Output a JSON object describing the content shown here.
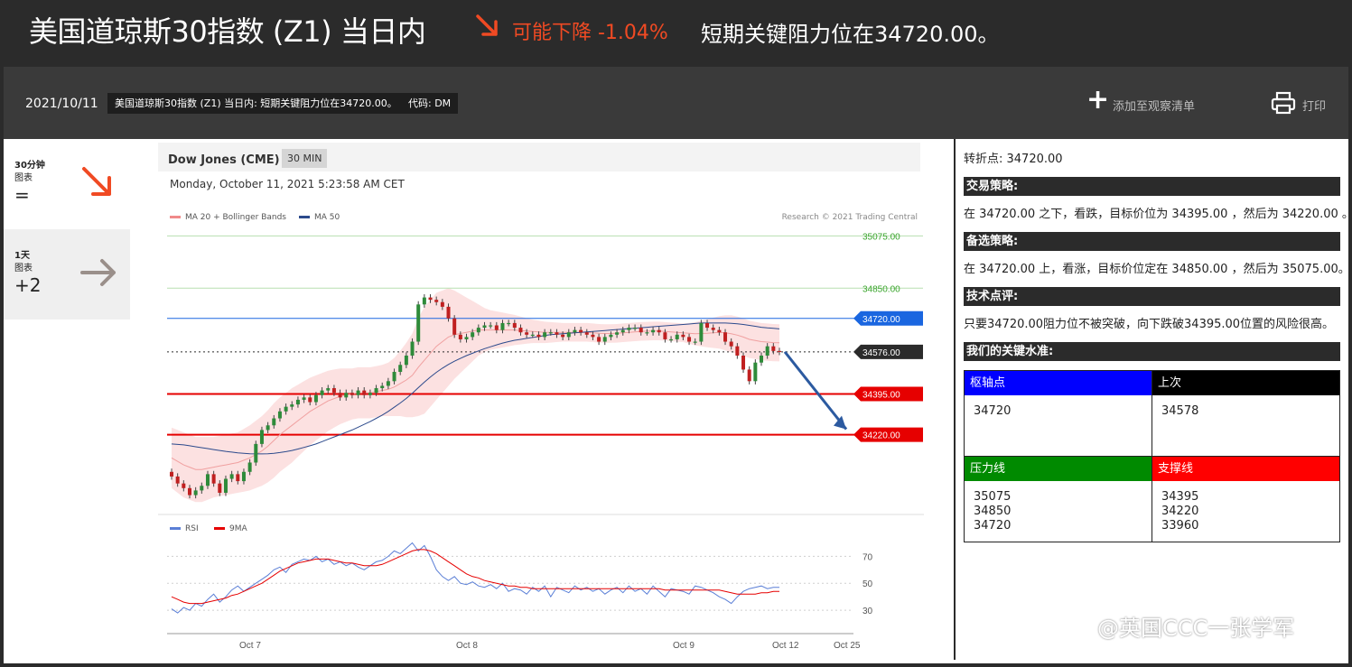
{
  "header": {
    "title": "美国道琼斯30指数 (Z1) 当日内",
    "trend_text": "可能下降 -1.04%",
    "headline": "短期关键阻力位在34720.00。",
    "colors": {
      "accent": "#f04a23"
    }
  },
  "subbar": {
    "date": "2021/10/11",
    "tag_title": "美国道琼斯30指数 (Z1) 当日内: 短期关键阻力位在34720.00。",
    "tag_code": "代码: DM",
    "watchlist_label": "添加至观察清单",
    "print_label": "打印"
  },
  "tabs": [
    {
      "title": "30分钟",
      "subtitle": "图表",
      "value": "="
    },
    {
      "title": "1天",
      "subtitle": "图表",
      "value": "+2"
    }
  ],
  "chart": {
    "name": "Dow Jones (CME)",
    "timeframe": "30 MIN",
    "datetime": "Monday, October 11, 2021 5:23:58 AM CET",
    "legend_ma20": "MA 20 + Bollinger Bands",
    "legend_ma50": "MA 50",
    "credit": "Research © 2021 Trading Central",
    "legend_rsi": "RSI",
    "legend_9ma": "9MA"
  },
  "chart_data": [
    {
      "type": "candlestick",
      "levels": [
        {
          "label": "35075.00",
          "value": 35075,
          "color": "#3aa52d"
        },
        {
          "label": "34850.00",
          "value": 34850,
          "color": "#3aa52d"
        },
        {
          "label": "34720.00",
          "value": 34720,
          "color": "#1a66e0"
        },
        {
          "label": "34576.00",
          "value": 34576,
          "color": "#2b2b2b"
        },
        {
          "label": "34395.00",
          "value": 34395,
          "color": "#e60000"
        },
        {
          "label": "34220.00",
          "value": 34220,
          "color": "#e60000"
        }
      ],
      "ylim": [
        33900,
        35150
      ],
      "closes": [
        34040,
        34010,
        33990,
        33960,
        33980,
        34000,
        34050,
        34010,
        33970,
        34030,
        34050,
        34020,
        34060,
        34100,
        34180,
        34240,
        34260,
        34290,
        34320,
        34340,
        34350,
        34370,
        34380,
        34360,
        34390,
        34410,
        34420,
        34400,
        34380,
        34400,
        34390,
        34410,
        34390,
        34400,
        34420,
        34430,
        34450,
        34490,
        34520,
        34560,
        34620,
        34780,
        34810,
        34800,
        34790,
        34770,
        34720,
        34650,
        34630,
        34640,
        34660,
        34680,
        34690,
        34690,
        34670,
        34700,
        34700,
        34680,
        34660,
        34650,
        34650,
        34640,
        34660,
        34660,
        34650,
        34640,
        34660,
        34670,
        34660,
        34650,
        34640,
        34620,
        34640,
        34650,
        34660,
        34670,
        34680,
        34680,
        34660,
        34660,
        34670,
        34660,
        34630,
        34630,
        34650,
        34640,
        34620,
        34620,
        34700,
        34680,
        34670,
        34660,
        34620,
        34600,
        34560,
        34500,
        34450,
        34530,
        34560,
        34600,
        34580,
        34576
      ],
      "ma20": [
        34120,
        34105,
        34090,
        34080,
        34070,
        34070,
        34075,
        34080,
        34085,
        34090,
        34095,
        34100,
        34110,
        34120,
        34135,
        34150,
        34170,
        34195,
        34220,
        34240,
        34260,
        34280,
        34300,
        34320,
        34335,
        34350,
        34365,
        34375,
        34385,
        34390,
        34395,
        34400,
        34400,
        34400,
        34405,
        34410,
        34415,
        34425,
        34440,
        34455,
        34475,
        34510,
        34540,
        34570,
        34600,
        34620,
        34640,
        34650,
        34655,
        34660,
        34665,
        34670,
        34670,
        34670,
        34670,
        34670,
        34670,
        34670,
        34668,
        34666,
        34664,
        34662,
        34660,
        34660,
        34660,
        34660,
        34660,
        34660,
        34660,
        34660,
        34658,
        34656,
        34655,
        34655,
        34656,
        34658,
        34660,
        34662,
        34664,
        34665,
        34666,
        34666,
        34664,
        34662,
        34660,
        34658,
        34656,
        34654,
        34655,
        34656,
        34658,
        34660,
        34658,
        34654,
        34648,
        34640,
        34630,
        34625,
        34620,
        34618,
        34616,
        34615
      ],
      "ma50": [
        34180,
        34178,
        34176,
        34172,
        34168,
        34164,
        34160,
        34156,
        34152,
        34148,
        34145,
        34142,
        34140,
        34138,
        34137,
        34137,
        34138,
        34140,
        34143,
        34147,
        34152,
        34158,
        34165,
        34172,
        34180,
        34190,
        34200,
        34210,
        34220,
        34230,
        34240,
        34252,
        34264,
        34276,
        34290,
        34304,
        34320,
        34338,
        34356,
        34376,
        34398,
        34422,
        34446,
        34468,
        34488,
        34506,
        34522,
        34536,
        34548,
        34560,
        34570,
        34580,
        34590,
        34598,
        34606,
        34614,
        34620,
        34626,
        34630,
        34634,
        34638,
        34642,
        34646,
        34650,
        34652,
        34654,
        34656,
        34658,
        34660,
        34662,
        34664,
        34666,
        34668,
        34670,
        34672,
        34674,
        34676,
        34678,
        34680,
        34682,
        34684,
        34686,
        34688,
        34690,
        34692,
        34694,
        34696,
        34698,
        34700,
        34700,
        34700,
        34700,
        34700,
        34699,
        34697,
        34694,
        34690,
        34686,
        34682,
        34679,
        34677,
        34675
      ],
      "band_width": [
        130,
        135,
        140,
        140,
        140,
        140,
        135,
        130,
        130,
        130,
        130,
        130,
        135,
        140,
        145,
        150,
        155,
        160,
        160,
        160,
        160,
        155,
        150,
        145,
        140,
        135,
        130,
        125,
        120,
        115,
        110,
        110,
        110,
        110,
        110,
        110,
        115,
        125,
        140,
        160,
        180,
        210,
        230,
        230,
        230,
        220,
        210,
        190,
        170,
        150,
        130,
        110,
        95,
        85,
        80,
        75,
        70,
        65,
        60,
        55,
        50,
        48,
        46,
        44,
        42,
        40,
        40,
        40,
        40,
        40,
        40,
        40,
        40,
        40,
        40,
        40,
        40,
        40,
        40,
        40,
        40,
        40,
        40,
        40,
        40,
        40,
        45,
        50,
        55,
        60,
        65,
        70,
        75,
        80,
        80,
        80,
        80,
        80,
        80,
        80,
        80,
        80
      ],
      "x_ticks": [
        "Oct 7",
        "Oct 8",
        "Oct 9",
        "Oct 12",
        "Oct 25"
      ],
      "projection_target": 34220
    },
    {
      "type": "line",
      "series": [
        {
          "name": "RSI",
          "color": "#5b7fd6",
          "values": [
            31,
            28,
            32,
            30,
            35,
            33,
            38,
            42,
            36,
            40,
            45,
            48,
            44,
            47,
            50,
            53,
            56,
            60,
            62,
            58,
            64,
            66,
            68,
            67,
            70,
            66,
            68,
            64,
            66,
            63,
            65,
            62,
            60,
            63,
            66,
            67,
            70,
            74,
            72,
            76,
            80,
            74,
            78,
            70,
            60,
            55,
            52,
            55,
            50,
            49,
            51,
            48,
            47,
            49,
            46,
            50,
            44,
            46,
            45,
            42,
            47,
            44,
            48,
            40,
            47,
            45,
            43,
            48,
            45,
            47,
            44,
            46,
            42,
            45,
            47,
            43,
            48,
            44,
            46,
            42,
            48,
            44,
            40,
            46,
            45,
            44,
            42,
            48,
            47,
            45,
            43,
            40,
            38,
            35,
            40,
            44,
            46,
            47,
            48,
            46,
            47,
            47
          ]
        },
        {
          "name": "9MA",
          "color": "#e60000",
          "values": [
            40,
            38,
            36,
            35,
            35,
            35,
            36,
            37,
            38,
            39,
            41,
            42,
            44,
            46,
            48,
            50,
            53,
            56,
            59,
            61,
            63,
            65,
            66,
            67,
            68,
            68,
            68,
            67,
            66,
            65,
            65,
            64,
            63,
            63,
            63,
            64,
            66,
            68,
            70,
            72,
            74,
            75,
            75,
            74,
            72,
            69,
            66,
            63,
            60,
            57,
            55,
            54,
            52,
            51,
            50,
            49,
            48,
            48,
            47,
            47,
            46,
            46,
            46,
            46,
            46,
            46,
            46,
            46,
            46,
            46,
            46,
            46,
            46,
            46,
            46,
            46,
            46,
            46,
            46,
            46,
            46,
            46,
            45,
            45,
            45,
            45,
            45,
            45,
            45,
            45,
            45,
            45,
            44,
            43,
            42,
            42,
            42,
            42,
            43,
            43,
            44,
            44
          ]
        }
      ],
      "ylim": [
        20,
        85
      ],
      "y_ticks": [
        70,
        50,
        30
      ]
    }
  ],
  "side": {
    "pivot": "转折点: 34720.00",
    "h1": "交易策略:",
    "t1": "在 34720.00 之下，看跌，目标价位为 34395.00 ，然后为 34220.00 。",
    "h2": "备选策略:",
    "t2": "在 34720.00 上，看涨，目标价位定在 34850.00 ，然后为 35075.00。",
    "h3": "技术点评:",
    "t3": "只要34720.00阻力位不被突破，向下跌破34395.00位置的风险很高。",
    "h4": "我们的关键水准:",
    "pivot_label": "枢轴点",
    "pivot_value": "34720",
    "last_label": "上次",
    "last_value": "34578",
    "res_label": "压力线",
    "res_values": "35075\n34850\n34720",
    "sup_label": "支撑线",
    "sup_values": "34395\n34220\n33960"
  },
  "watermark": "@英国CCC一张学军"
}
